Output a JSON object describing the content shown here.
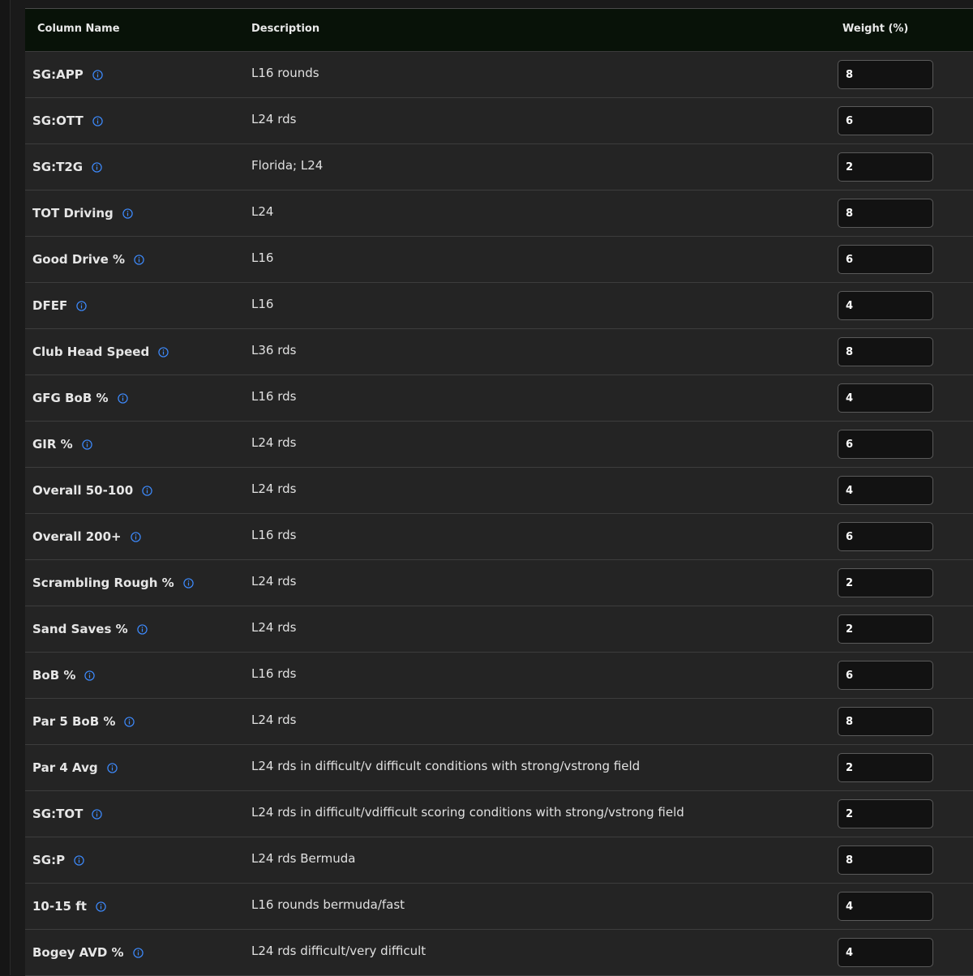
{
  "header": {
    "column_name": "Column Name",
    "description": "Description",
    "weight": "Weight (%)"
  },
  "colors": {
    "header_bg": "#081208",
    "row_bg": "#242424",
    "info_icon": "#3d8bff",
    "input_bg": "#121212"
  },
  "icons": {
    "info": "info-circle-icon"
  },
  "rows": [
    {
      "name": "SG:APP",
      "description": "L16 rounds",
      "weight": "8"
    },
    {
      "name": "SG:OTT",
      "description": "L24 rds",
      "weight": "6"
    },
    {
      "name": "SG:T2G",
      "description": "Florida; L24",
      "weight": "2"
    },
    {
      "name": "TOT Driving",
      "description": "L24",
      "weight": "8"
    },
    {
      "name": "Good Drive %",
      "description": "L16",
      "weight": "6"
    },
    {
      "name": "DFEF",
      "description": "L16",
      "weight": "4"
    },
    {
      "name": "Club Head Speed",
      "description": "L36 rds",
      "weight": "8"
    },
    {
      "name": "GFG BoB %",
      "description": "L16 rds",
      "weight": "4"
    },
    {
      "name": "GIR %",
      "description": "L24 rds",
      "weight": "6"
    },
    {
      "name": "Overall 50-100",
      "description": "L24 rds",
      "weight": "4"
    },
    {
      "name": "Overall 200+",
      "description": "L16 rds",
      "weight": "6"
    },
    {
      "name": "Scrambling Rough %",
      "description": "L24 rds",
      "weight": "2"
    },
    {
      "name": "Sand Saves %",
      "description": "L24 rds",
      "weight": "2"
    },
    {
      "name": "BoB %",
      "description": "L16 rds",
      "weight": "6"
    },
    {
      "name": "Par 5 BoB %",
      "description": "L24 rds",
      "weight": "8"
    },
    {
      "name": "Par 4 Avg",
      "description": "L24 rds in difficult/v difficult conditions with strong/vstrong field",
      "weight": "2"
    },
    {
      "name": "SG:TOT",
      "description": "L24 rds in difficult/vdifficult scoring conditions with strong/vstrong field",
      "weight": "2"
    },
    {
      "name": "SG:P",
      "description": "L24 rds Bermuda",
      "weight": "8"
    },
    {
      "name": "10-15 ft",
      "description": "L16 rounds bermuda/fast",
      "weight": "4"
    },
    {
      "name": "Bogey AVD %",
      "description": "L24 rds difficult/very difficult",
      "weight": "4"
    }
  ]
}
